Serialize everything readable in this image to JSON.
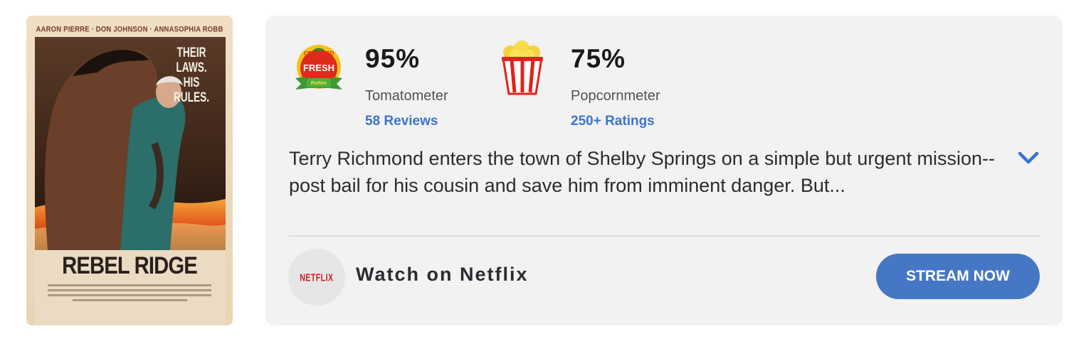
{
  "poster": {
    "credits": "AARON PIERRE · DON JOHNSON · ANNASOPHIA ROBB",
    "tagline": [
      "THEIR",
      "LAWS.",
      "HIS",
      "RULES."
    ],
    "title": "REBEL RIDGE"
  },
  "tomatometer": {
    "score": "95%",
    "label": "Tomatometer",
    "reviews_link": "58 Reviews",
    "badge_text": "CERTIFIED FRESH",
    "icon": "certified-fresh-icon",
    "color": "#e02a1a"
  },
  "popcornmeter": {
    "score": "75%",
    "label": "Popcornmeter",
    "ratings_link": "250+ Ratings",
    "icon": "popcorn-bucket-icon",
    "color": "#e2231a"
  },
  "synopsis": {
    "text": "Terry Richmond enters the town of Shelby Springs on a simple but urgent mission-- post bail for his cousin and save him from imminent danger. But...",
    "expand_icon": "chevron-down-icon"
  },
  "streaming": {
    "provider_logo": "NETFLIX",
    "watch_label": "Watch on Netflix",
    "button_label": "STREAM NOW",
    "button_color": "#4677c4"
  },
  "colors": {
    "link": "#3a74d0",
    "card_bg": "#f2f2f2"
  }
}
